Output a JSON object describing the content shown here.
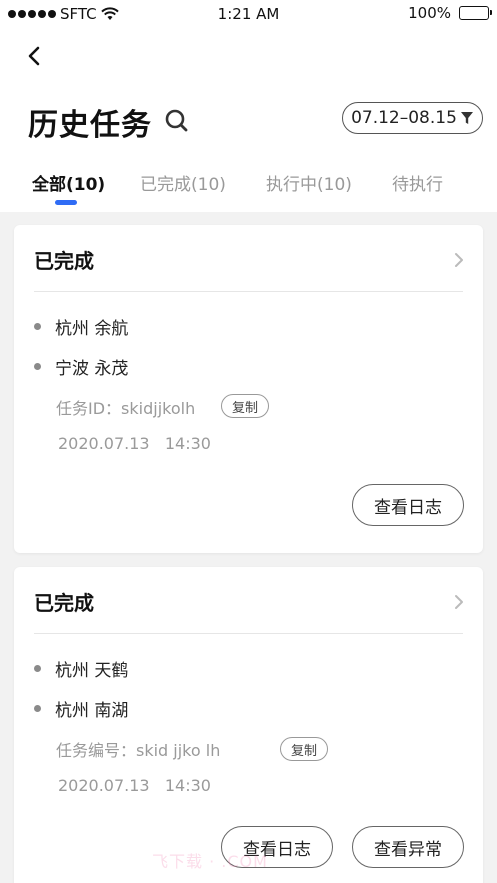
{
  "status_bar": {
    "carrier": "SFTC",
    "time": "1:21 AM",
    "battery": "100%"
  },
  "header": {
    "title": "历史任务",
    "date_range": "07.12–08.15"
  },
  "tabs": [
    {
      "label": "全部(10)"
    },
    {
      "label": "已完成(10)"
    },
    {
      "label": "执行中(10)"
    },
    {
      "label": "待执行"
    }
  ],
  "cards": [
    {
      "status": "已完成",
      "locations": [
        "杭州 余航",
        "宁波 永茂"
      ],
      "task_id": "任务ID：skidjjkolh",
      "copy_label": "复制",
      "time": "2020.07.13   14:30",
      "buttons": [
        "查看日志"
      ]
    },
    {
      "status": "已完成",
      "locations": [
        "杭州 天鹤",
        "杭州 南湖"
      ],
      "task_id": "任务编号：skid jjko lh",
      "copy_label": "复制",
      "time": "2020.07.13   14:30",
      "buttons": [
        "查看日志",
        "查看异常"
      ]
    }
  ],
  "watermark": "飞下载 · .COM",
  "colors": {
    "accent": "#2f6cf5",
    "background": "#f2f2f2"
  }
}
